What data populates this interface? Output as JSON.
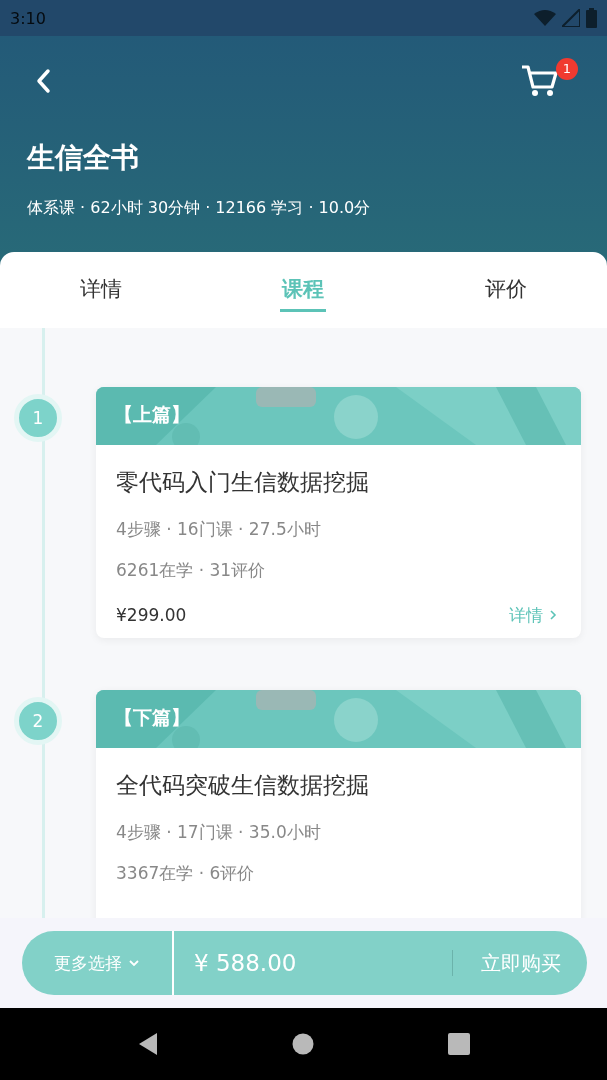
{
  "status_bar": {
    "time": "3:10"
  },
  "header": {
    "cart_count": "1",
    "title": "生信全书",
    "meta": "体系课 · 62小时 30分钟 · 12166 学习 · 10.0分"
  },
  "tabs": [
    {
      "label": "详情",
      "selected": false
    },
    {
      "label": "课程",
      "selected": true
    },
    {
      "label": "评价",
      "selected": false
    }
  ],
  "courses": [
    {
      "step": "1",
      "part": "【上篇】",
      "title": "零代码入门生信数据挖掘",
      "stats": "4步骤 · 16门课 · 27.5小时",
      "social": "6261在学 · 31评价",
      "price": "¥299.00",
      "link": "详情"
    },
    {
      "step": "2",
      "part": "【下篇】",
      "title": "全代码突破生信数据挖掘",
      "stats": "4步骤 · 17门课 · 35.0小时",
      "social": "3367在学 · 6评价"
    }
  ],
  "bottom_bar": {
    "more": "更多选择",
    "total": "¥ 588.00",
    "buy": "立即购买"
  }
}
